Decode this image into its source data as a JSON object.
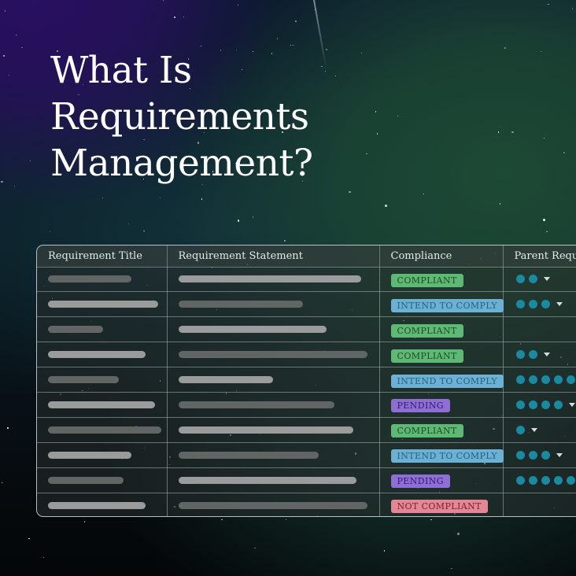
{
  "headline": "What Is Requirements Management?",
  "table": {
    "headers": [
      "Requirement Title",
      "Requirement Statement",
      "Compliance",
      "Parent Requ"
    ],
    "rows": [
      {
        "compliance": "COMPLIANT",
        "status": "compliant",
        "parent_dots": 2,
        "caret": true
      },
      {
        "compliance": "INTEND TO COMPLY",
        "status": "intend",
        "parent_dots": 3,
        "caret": true
      },
      {
        "compliance": "COMPLIANT",
        "status": "compliant",
        "parent_dots": 0,
        "caret": false
      },
      {
        "compliance": "COMPLIANT",
        "status": "compliant",
        "parent_dots": 2,
        "caret": true
      },
      {
        "compliance": "INTEND TO COMPLY",
        "status": "intend",
        "parent_dots": 5,
        "caret": false
      },
      {
        "compliance": "PENDING",
        "status": "pending",
        "parent_dots": 4,
        "caret": true
      },
      {
        "compliance": "COMPLIANT",
        "status": "compliant",
        "parent_dots": 1,
        "caret": true
      },
      {
        "compliance": "INTEND TO COMPLY",
        "status": "intend",
        "parent_dots": 3,
        "caret": true
      },
      {
        "compliance": "PENDING",
        "status": "pending",
        "parent_dots": 5,
        "caret": false
      },
      {
        "compliance": "NOT COMPLIANT",
        "status": "not",
        "parent_dots": 0,
        "caret": false
      }
    ]
  },
  "colors": {
    "compliant": "#5eb974",
    "intend": "#6cb0d3",
    "pending": "#8e6fd3",
    "not_compliant": "#e38795",
    "parent_dot": "#1a8aa0"
  }
}
